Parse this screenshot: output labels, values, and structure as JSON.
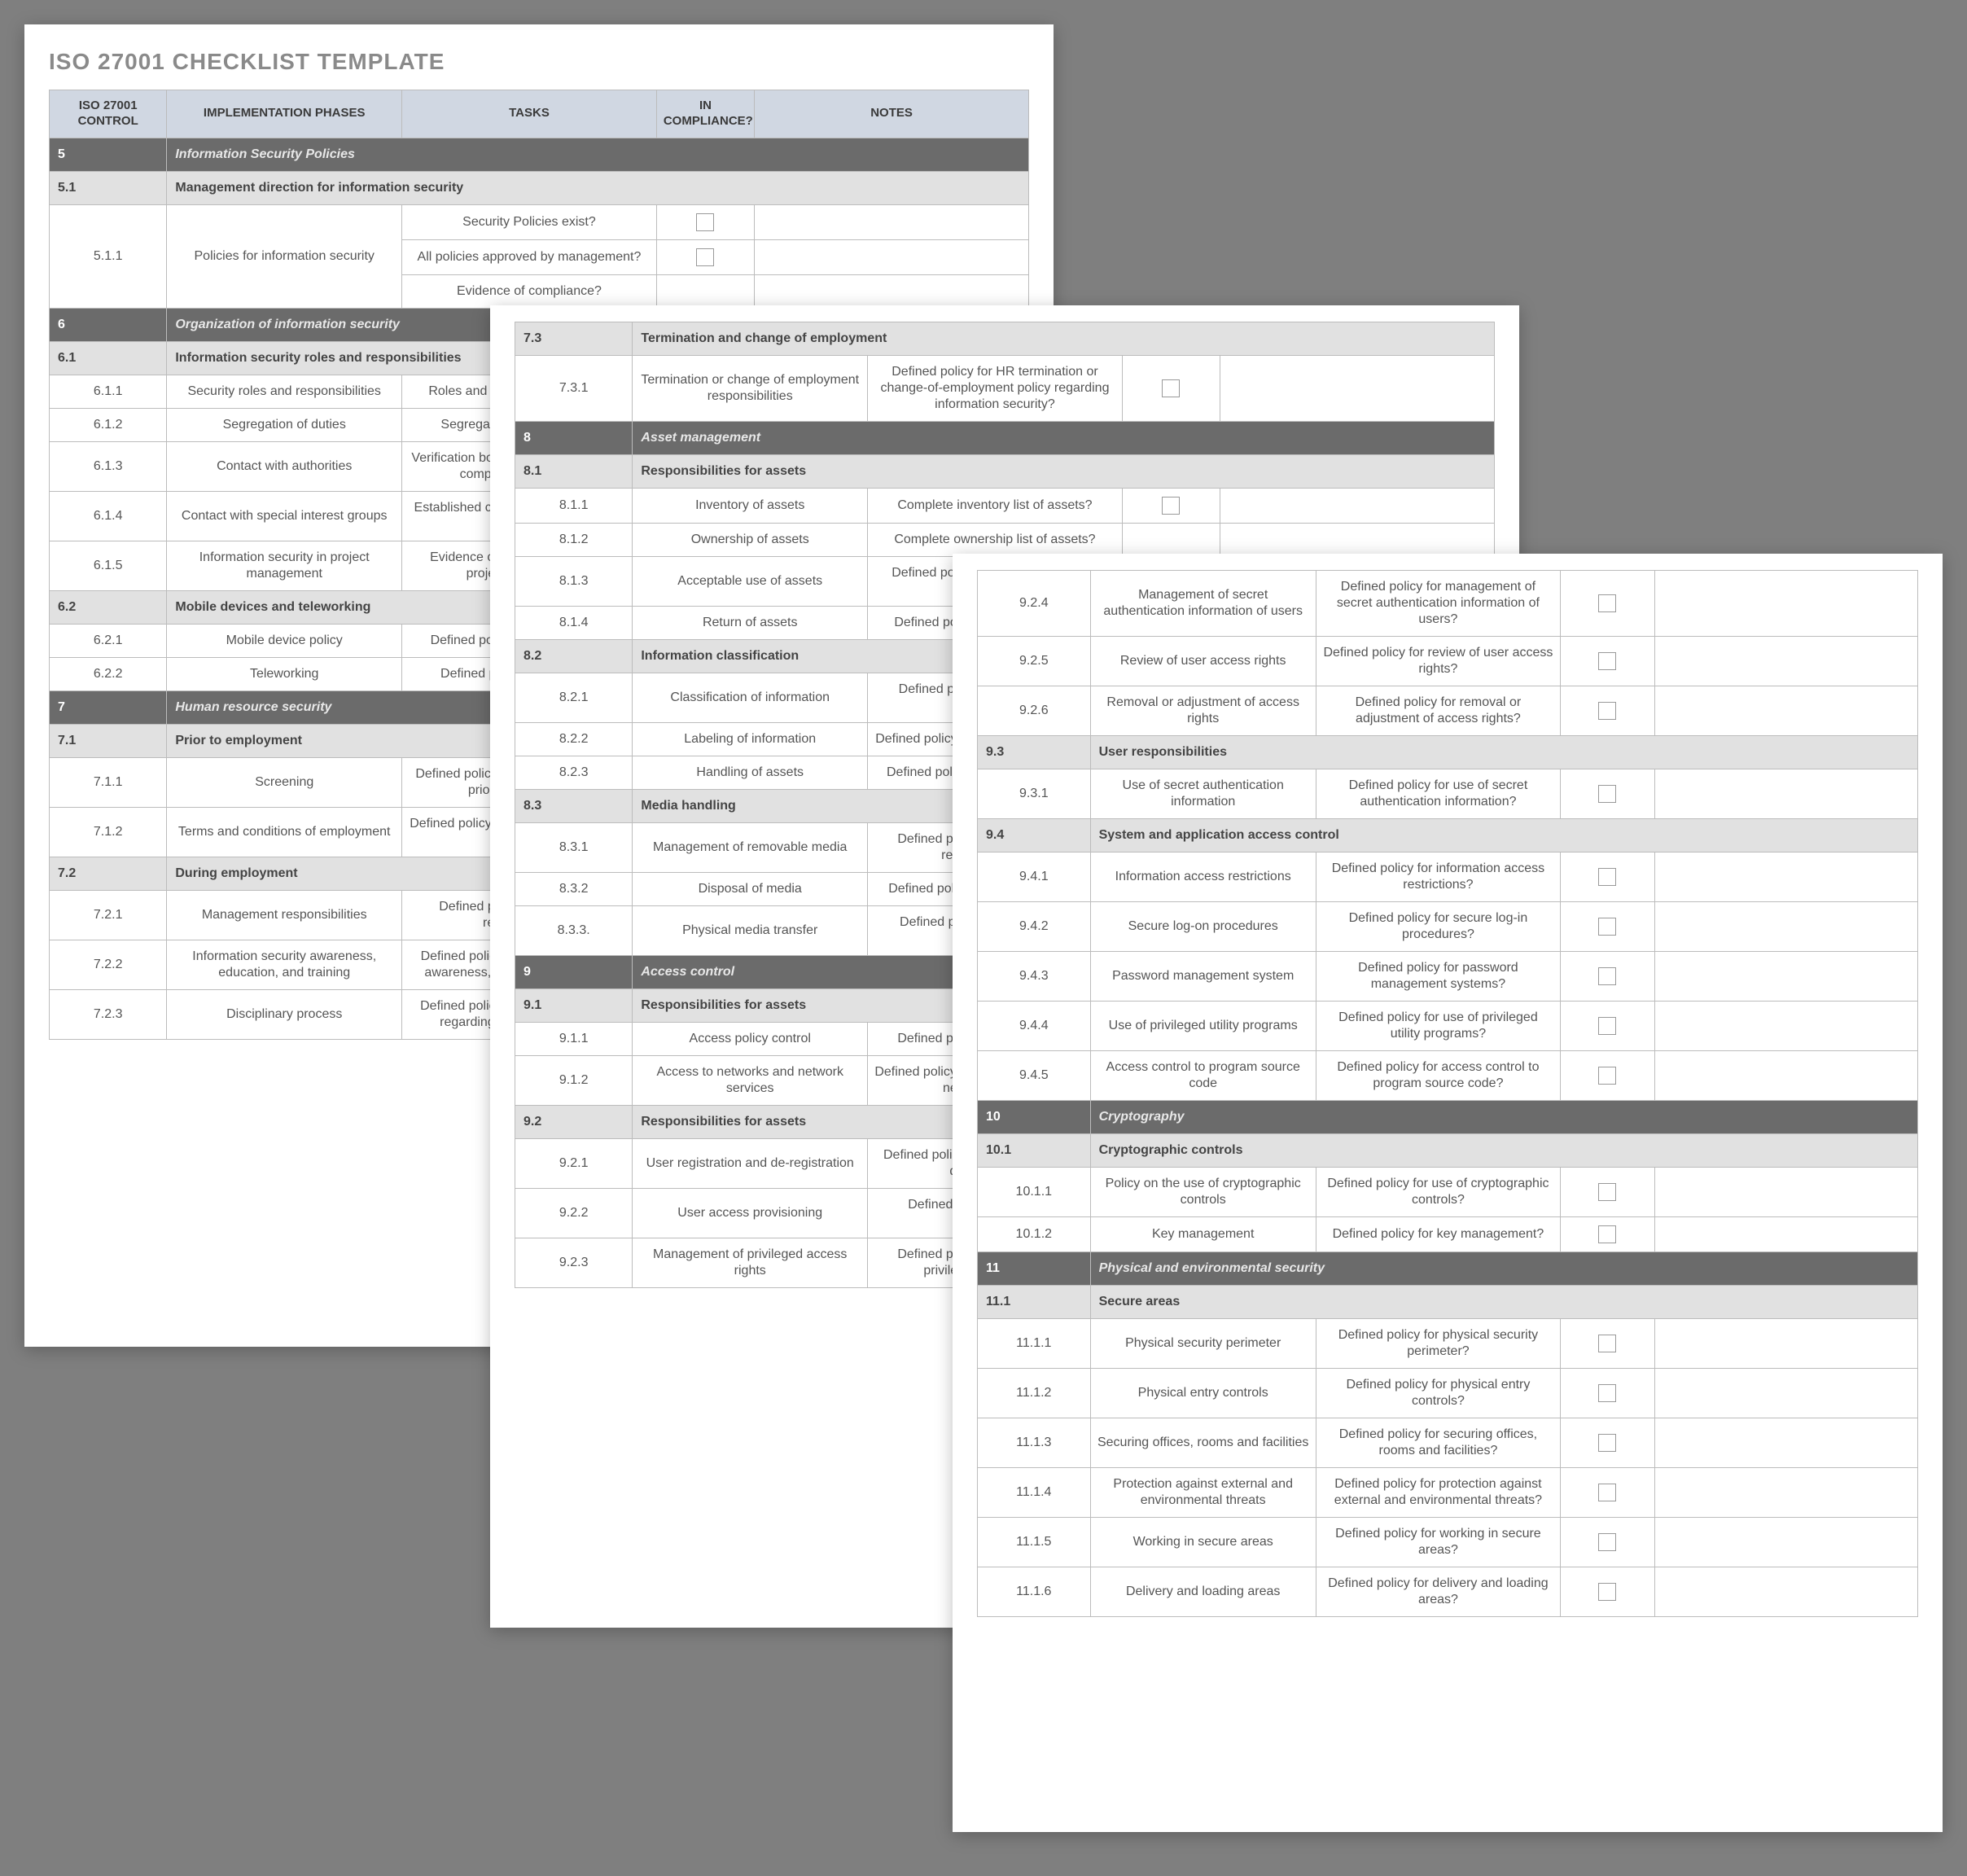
{
  "title": "ISO 27001 CHECKLIST TEMPLATE",
  "headers": {
    "control": "ISO 27001 CONTROL",
    "phases": "IMPLEMENTATION PHASES",
    "tasks": "TASKS",
    "compliance": "IN COMPLIANCE?",
    "notes": "NOTES"
  },
  "pages": [
    {
      "showTitle": true,
      "showHeader": true,
      "rows": [
        {
          "type": "major",
          "id": "5",
          "label": "Information Security Policies"
        },
        {
          "type": "sub",
          "id": "5.1",
          "label": "Management direction for information security"
        },
        {
          "type": "item",
          "id": "5.1.1",
          "phases": "Policies for information security",
          "tasks": "Security Policies exist?",
          "checkbox": true,
          "rowspan": 3
        },
        {
          "type": "subitem",
          "tasks": "All policies approved by management?",
          "checkbox": true
        },
        {
          "type": "subitem",
          "tasks": "Evidence of compliance?",
          "checkbox": false
        },
        {
          "type": "major",
          "id": "6",
          "label": "Organization of information security"
        },
        {
          "type": "sub",
          "id": "6.1",
          "label": "Information security roles and responsibilities"
        },
        {
          "type": "item",
          "id": "6.1.1",
          "phases": "Security roles and responsibilities",
          "tasks": "Roles and responsibilities defined?"
        },
        {
          "type": "item",
          "id": "6.1.2",
          "phases": "Segregation of duties",
          "tasks": "Segregation of duties defined?"
        },
        {
          "type": "item",
          "id": "6.1.3",
          "phases": "Contact with authorities",
          "tasks": "Verification body / authority contacted for compliance verification?"
        },
        {
          "type": "item",
          "id": "6.1.4",
          "phases": "Contact with special interest groups",
          "tasks": "Established contact with special interest groups?"
        },
        {
          "type": "item",
          "id": "6.1.5",
          "phases": "Information security in project management",
          "tasks": "Evidence of information security in project management?"
        },
        {
          "type": "sub",
          "id": "6.2",
          "label": "Mobile devices and teleworking"
        },
        {
          "type": "item",
          "id": "6.2.1",
          "phases": "Mobile device policy",
          "tasks": "Defined policy for mobile devices?"
        },
        {
          "type": "item",
          "id": "6.2.2",
          "phases": "Teleworking",
          "tasks": "Defined policy for teleworking?"
        },
        {
          "type": "major",
          "id": "7",
          "label": "Human resource security"
        },
        {
          "type": "sub",
          "id": "7.1",
          "label": "Prior to employment"
        },
        {
          "type": "item",
          "id": "7.1.1",
          "phases": "Screening",
          "tasks": "Defined policy for screening employees prior to employment?"
        },
        {
          "type": "item",
          "id": "7.1.2",
          "phases": "Terms and conditions of employment",
          "tasks": "Defined policy for terms and conditions of employment?"
        },
        {
          "type": "sub",
          "id": "7.2",
          "label": "During employment"
        },
        {
          "type": "item",
          "id": "7.2.1",
          "phases": "Management responsibilities",
          "tasks": "Defined policy for management responsibilities?"
        },
        {
          "type": "item",
          "id": "7.2.2",
          "phases": "Information security awareness, education, and training",
          "tasks": "Defined policy for information security awareness, education, and training?"
        },
        {
          "type": "item",
          "id": "7.2.3",
          "phases": "Disciplinary process",
          "tasks": "Defined policy for disciplinary process regarding information security?"
        }
      ]
    },
    {
      "showTitle": false,
      "showHeader": false,
      "rows": [
        {
          "type": "sub",
          "id": "7.3",
          "label": "Termination and change of employment"
        },
        {
          "type": "item",
          "id": "7.3.1",
          "phases": "Termination or change of employment responsibilities",
          "tasks": "Defined policy for HR termination or change-of-employment policy regarding information security?",
          "checkbox": true
        },
        {
          "type": "major",
          "id": "8",
          "label": "Asset management"
        },
        {
          "type": "sub",
          "id": "8.1",
          "label": "Responsibilities for assets"
        },
        {
          "type": "item",
          "id": "8.1.1",
          "phases": "Inventory of assets",
          "tasks": "Complete inventory list of assets?",
          "checkbox": true
        },
        {
          "type": "item",
          "id": "8.1.2",
          "phases": "Ownership of assets",
          "tasks": "Complete ownership list of assets?"
        },
        {
          "type": "item",
          "id": "8.1.3",
          "phases": "Acceptable use of assets",
          "tasks": "Defined policy for acceptable use of assets?"
        },
        {
          "type": "item",
          "id": "8.1.4",
          "phases": "Return of assets",
          "tasks": "Defined policy for return of assets?"
        },
        {
          "type": "sub",
          "id": "8.2",
          "label": "Information classification"
        },
        {
          "type": "item",
          "id": "8.2.1",
          "phases": "Classification of information",
          "tasks": "Defined policy for classification of information?"
        },
        {
          "type": "item",
          "id": "8.2.2",
          "phases": "Labeling of information",
          "tasks": "Defined policy for labeling of information?"
        },
        {
          "type": "item",
          "id": "8.2.3",
          "phases": "Handling of assets",
          "tasks": "Defined policy for handling of assets?"
        },
        {
          "type": "sub",
          "id": "8.3",
          "label": "Media handling"
        },
        {
          "type": "item",
          "id": "8.3.1",
          "phases": "Management of removable media",
          "tasks": "Defined policy for management of removable media?"
        },
        {
          "type": "item",
          "id": "8.3.2",
          "phases": "Disposal of media",
          "tasks": "Defined policy for disposal of media?"
        },
        {
          "type": "item",
          "id": "8.3.3.",
          "phases": "Physical media transfer",
          "tasks": "Defined policy for physical media transfer?"
        },
        {
          "type": "major",
          "id": "9",
          "label": "Access control"
        },
        {
          "type": "sub",
          "id": "9.1",
          "label": "Responsibilities for assets"
        },
        {
          "type": "item",
          "id": "9.1.1",
          "phases": "Access policy control",
          "tasks": "Defined policy for access control?"
        },
        {
          "type": "item",
          "id": "9.1.2",
          "phases": "Access to networks and network services",
          "tasks": "Defined policy for access to networks and network services?"
        },
        {
          "type": "sub",
          "id": "9.2",
          "label": "Responsibilities for assets"
        },
        {
          "type": "item",
          "id": "9.2.1",
          "phases": "User registration and de-registration",
          "tasks": "Defined policy for user registration and de-registration?"
        },
        {
          "type": "item",
          "id": "9.2.2",
          "phases": "User access provisioning",
          "tasks": "Defined policy for user access provisioning?"
        },
        {
          "type": "item",
          "id": "9.2.3",
          "phases": "Management of privileged access rights",
          "tasks": "Defined policy for management of privileged access rights?"
        }
      ]
    },
    {
      "showTitle": false,
      "showHeader": false,
      "rows": [
        {
          "type": "item",
          "id": "9.2.4",
          "phases": "Management of secret authentication information of users",
          "tasks": "Defined policy for management of secret authentication information of users?",
          "checkbox": true
        },
        {
          "type": "item",
          "id": "9.2.5",
          "phases": "Review of user access rights",
          "tasks": "Defined policy for review of user access rights?",
          "checkbox": true
        },
        {
          "type": "item",
          "id": "9.2.6",
          "phases": "Removal or adjustment of access rights",
          "tasks": "Defined policy for removal or adjustment of access rights?",
          "checkbox": true
        },
        {
          "type": "sub",
          "id": "9.3",
          "label": "User responsibilities"
        },
        {
          "type": "item",
          "id": "9.3.1",
          "phases": "Use of secret authentication information",
          "tasks": "Defined policy for use of secret authentication information?",
          "checkbox": true
        },
        {
          "type": "sub",
          "id": "9.4",
          "label": "System and application access control"
        },
        {
          "type": "item",
          "id": "9.4.1",
          "phases": "Information access restrictions",
          "tasks": "Defined policy for information access restrictions?",
          "checkbox": true
        },
        {
          "type": "item",
          "id": "9.4.2",
          "phases": "Secure log-on procedures",
          "tasks": "Defined policy for secure log-in procedures?",
          "checkbox": true
        },
        {
          "type": "item",
          "id": "9.4.3",
          "phases": "Password management system",
          "tasks": "Defined policy for password management systems?",
          "checkbox": true
        },
        {
          "type": "item",
          "id": "9.4.4",
          "phases": "Use of privileged utility programs",
          "tasks": "Defined policy for use of privileged utility programs?",
          "checkbox": true
        },
        {
          "type": "item",
          "id": "9.4.5",
          "phases": "Access control to program source code",
          "tasks": "Defined policy for access control to program source code?",
          "checkbox": true
        },
        {
          "type": "major",
          "id": "10",
          "label": "Cryptography"
        },
        {
          "type": "sub",
          "id": "10.1",
          "label": "Cryptographic controls"
        },
        {
          "type": "item",
          "id": "10.1.1",
          "phases": "Policy on the use of cryptographic controls",
          "tasks": "Defined policy for use of cryptographic controls?",
          "checkbox": true
        },
        {
          "type": "item",
          "id": "10.1.2",
          "phases": "Key management",
          "tasks": "Defined policy for key management?",
          "checkbox": true
        },
        {
          "type": "major",
          "id": "11",
          "label": "Physical and environmental security"
        },
        {
          "type": "sub",
          "id": "11.1",
          "label": "Secure areas"
        },
        {
          "type": "item",
          "id": "11.1.1",
          "phases": "Physical security perimeter",
          "tasks": "Defined policy for physical security perimeter?",
          "checkbox": true
        },
        {
          "type": "item",
          "id": "11.1.2",
          "phases": "Physical entry controls",
          "tasks": "Defined policy for physical entry controls?",
          "checkbox": true
        },
        {
          "type": "item",
          "id": "11.1.3",
          "phases": "Securing offices, rooms and facilities",
          "tasks": "Defined policy for securing offices, rooms and facilities?",
          "checkbox": true
        },
        {
          "type": "item",
          "id": "11.1.4",
          "phases": "Protection against external and environmental threats",
          "tasks": "Defined policy for protection against external and environmental threats?",
          "checkbox": true
        },
        {
          "type": "item",
          "id": "11.1.5",
          "phases": "Working in secure areas",
          "tasks": "Defined policy for working in secure areas?",
          "checkbox": true
        },
        {
          "type": "item",
          "id": "11.1.6",
          "phases": "Delivery and loading areas",
          "tasks": "Defined policy for delivery and loading areas?",
          "checkbox": true
        }
      ]
    }
  ]
}
